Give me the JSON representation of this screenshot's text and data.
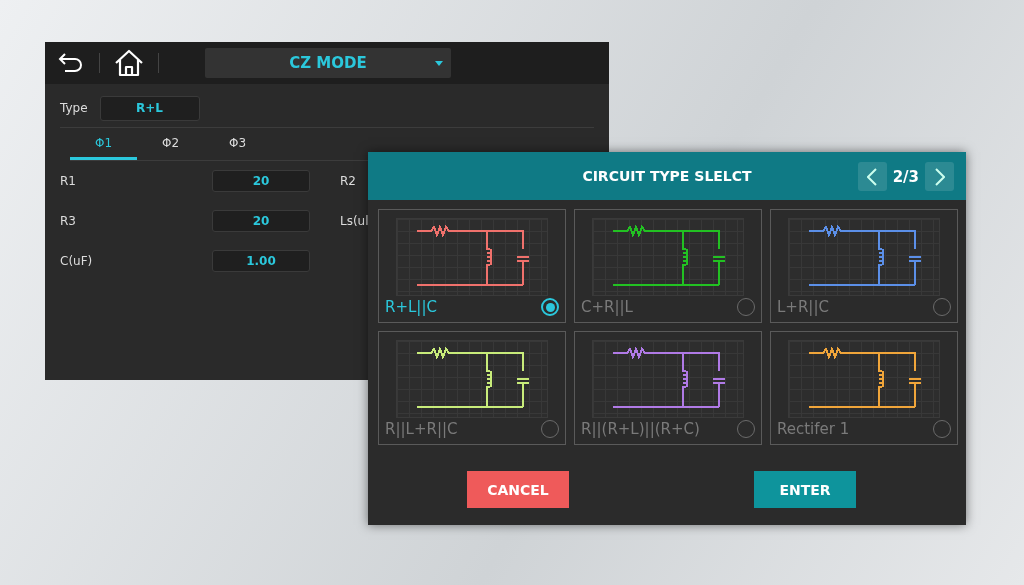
{
  "mode_window": {
    "mode_select": {
      "value": "CZ MODE"
    },
    "type": {
      "label": "Type",
      "value": "R+L"
    },
    "tabs": [
      {
        "label": "Φ1",
        "selected": true
      },
      {
        "label": "Φ2",
        "selected": false
      },
      {
        "label": "Φ3",
        "selected": false
      }
    ],
    "fields": [
      {
        "label": "R1",
        "value": "20"
      },
      {
        "label": "R3",
        "value": "20"
      },
      {
        "label": "C(uF)",
        "value": "1.00"
      }
    ],
    "right_labels": [
      "R2",
      "Ls(ul"
    ]
  },
  "dialog": {
    "title": "CIRCUIT TYPE SLELCT",
    "page": "2/3",
    "options": [
      {
        "label": "R+L||C",
        "selected": true,
        "color": "#f0716c"
      },
      {
        "label": "C+R||L",
        "selected": false,
        "color": "#22c122"
      },
      {
        "label": "L+R||C",
        "selected": false,
        "color": "#5b8fe8"
      },
      {
        "label": "R||L+R||C",
        "selected": false,
        "color": "#c8ec7a"
      },
      {
        "label": "R||(R+L)||(R+C)",
        "selected": false,
        "color": "#b07ae6"
      },
      {
        "label": "Rectifer 1",
        "selected": false,
        "color": "#f0a53a"
      }
    ],
    "buttons": {
      "cancel": "CANCEL",
      "enter": "ENTER"
    }
  }
}
